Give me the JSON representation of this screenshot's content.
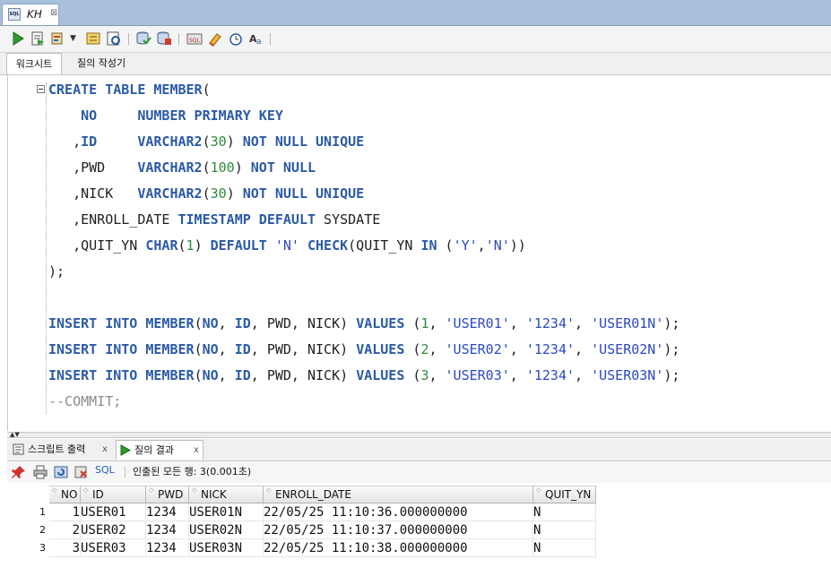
{
  "document_tab": {
    "title": "KH",
    "icon": "sql-file-icon",
    "close": "⊠"
  },
  "worksheet_tabs": {
    "worksheet": "워크시트",
    "query_builder": "질의 작성기"
  },
  "editor": {
    "lines": [
      [
        [
          "k",
          "CREATE TABLE MEMBER"
        ],
        [
          "p",
          "("
        ]
      ],
      [
        [
          "p",
          "    "
        ],
        [
          "k",
          "NO"
        ],
        [
          "p",
          "     "
        ],
        [
          "k",
          "NUMBER PRIMARY KEY"
        ]
      ],
      [
        [
          "p",
          "   ,"
        ],
        [
          "k",
          "ID"
        ],
        [
          "p",
          "     "
        ],
        [
          "k",
          "VARCHAR2"
        ],
        [
          "p",
          "("
        ],
        [
          "n",
          "30"
        ],
        [
          "p",
          ") "
        ],
        [
          "k",
          "NOT NULL UNIQUE"
        ]
      ],
      [
        [
          "p",
          "   ,PWD    "
        ],
        [
          "k",
          "VARCHAR2"
        ],
        [
          "p",
          "("
        ],
        [
          "n",
          "100"
        ],
        [
          "p",
          ") "
        ],
        [
          "k",
          "NOT NULL"
        ]
      ],
      [
        [
          "p",
          "   ,NICK   "
        ],
        [
          "k",
          "VARCHAR2"
        ],
        [
          "p",
          "("
        ],
        [
          "n",
          "30"
        ],
        [
          "p",
          ") "
        ],
        [
          "k",
          "NOT NULL UNIQUE"
        ]
      ],
      [
        [
          "p",
          "   ,ENROLL_DATE "
        ],
        [
          "k",
          "TIMESTAMP DEFAULT"
        ],
        [
          "p",
          " SYSDATE"
        ]
      ],
      [
        [
          "p",
          "   ,QUIT_YN "
        ],
        [
          "k",
          "CHAR"
        ],
        [
          "p",
          "("
        ],
        [
          "n",
          "1"
        ],
        [
          "p",
          ") "
        ],
        [
          "k",
          "DEFAULT"
        ],
        [
          "p",
          " "
        ],
        [
          "s",
          "'N'"
        ],
        [
          "p",
          " "
        ],
        [
          "k",
          "CHECK"
        ],
        [
          "p",
          "(QUIT_YN "
        ],
        [
          "k",
          "IN"
        ],
        [
          "p",
          " ("
        ],
        [
          "s",
          "'Y'"
        ],
        [
          "p",
          ","
        ],
        [
          "s",
          "'N'"
        ],
        [
          "p",
          "))"
        ]
      ],
      [
        [
          "p",
          ");"
        ]
      ],
      [
        [
          "p",
          ""
        ]
      ],
      [
        [
          "k",
          "INSERT INTO MEMBER"
        ],
        [
          "p",
          "("
        ],
        [
          "k",
          "NO"
        ],
        [
          "p",
          ", "
        ],
        [
          "k",
          "ID"
        ],
        [
          "p",
          ", PWD, NICK) "
        ],
        [
          "k",
          "VALUES"
        ],
        [
          "p",
          " ("
        ],
        [
          "n",
          "1"
        ],
        [
          "p",
          ", "
        ],
        [
          "s",
          "'USER01'"
        ],
        [
          "p",
          ", "
        ],
        [
          "s",
          "'1234'"
        ],
        [
          "p",
          ", "
        ],
        [
          "s",
          "'USER01N'"
        ],
        [
          "p",
          ");"
        ]
      ],
      [
        [
          "k",
          "INSERT INTO MEMBER"
        ],
        [
          "p",
          "("
        ],
        [
          "k",
          "NO"
        ],
        [
          "p",
          ", "
        ],
        [
          "k",
          "ID"
        ],
        [
          "p",
          ", PWD, NICK) "
        ],
        [
          "k",
          "VALUES"
        ],
        [
          "p",
          " ("
        ],
        [
          "n",
          "2"
        ],
        [
          "p",
          ", "
        ],
        [
          "s",
          "'USER02'"
        ],
        [
          "p",
          ", "
        ],
        [
          "s",
          "'1234'"
        ],
        [
          "p",
          ", "
        ],
        [
          "s",
          "'USER02N'"
        ],
        [
          "p",
          ");"
        ]
      ],
      [
        [
          "k",
          "INSERT INTO MEMBER"
        ],
        [
          "p",
          "("
        ],
        [
          "k",
          "NO"
        ],
        [
          "p",
          ", "
        ],
        [
          "k",
          "ID"
        ],
        [
          "p",
          ", PWD, NICK) "
        ],
        [
          "k",
          "VALUES"
        ],
        [
          "p",
          " ("
        ],
        [
          "n",
          "3"
        ],
        [
          "p",
          ", "
        ],
        [
          "s",
          "'USER03'"
        ],
        [
          "p",
          ", "
        ],
        [
          "s",
          "'1234'"
        ],
        [
          "p",
          ", "
        ],
        [
          "s",
          "'USER03N'"
        ],
        [
          "p",
          ");"
        ]
      ],
      [
        [
          "c",
          "--COMMIT;"
        ]
      ]
    ]
  },
  "result_tabs": {
    "script_output": "스크립트 출력",
    "query_result": "질의 결과",
    "close": "x"
  },
  "result_toolbar": {
    "sql_label": "SQL",
    "status": "인출된 모든 행: 3(0.001초)"
  },
  "grid": {
    "columns": [
      "NO",
      "ID",
      "PWD",
      "NICK",
      "ENROLL_DATE",
      "QUIT_YN"
    ],
    "rows": [
      {
        "rownum": "1",
        "cells": [
          "1",
          "USER01",
          "1234",
          "USER01N",
          "22/05/25 11:10:36.000000000",
          "N"
        ]
      },
      {
        "rownum": "2",
        "cells": [
          "2",
          "USER02",
          "1234",
          "USER02N",
          "22/05/25 11:10:37.000000000",
          "N"
        ]
      },
      {
        "rownum": "3",
        "cells": [
          "3",
          "USER03",
          "1234",
          "USER03N",
          "22/05/25 11:10:38.000000000",
          "N"
        ]
      }
    ]
  },
  "colors": {
    "keyword": "#2b5aa6",
    "string": "#2c49c4",
    "number": "#2e8b3a",
    "comment": "#8a8a8a",
    "tabstrip": "#a9c0dc"
  },
  "icons": [
    "run-statement-icon",
    "run-script-icon",
    "autotrace-icon",
    "explain-plan-icon",
    "commit-icon",
    "rollback-icon",
    "sql-tuning-icon",
    "clear-icon",
    "history-icon",
    "format-icon",
    "pin-icon",
    "print-icon",
    "refresh-icon",
    "export-icon"
  ]
}
